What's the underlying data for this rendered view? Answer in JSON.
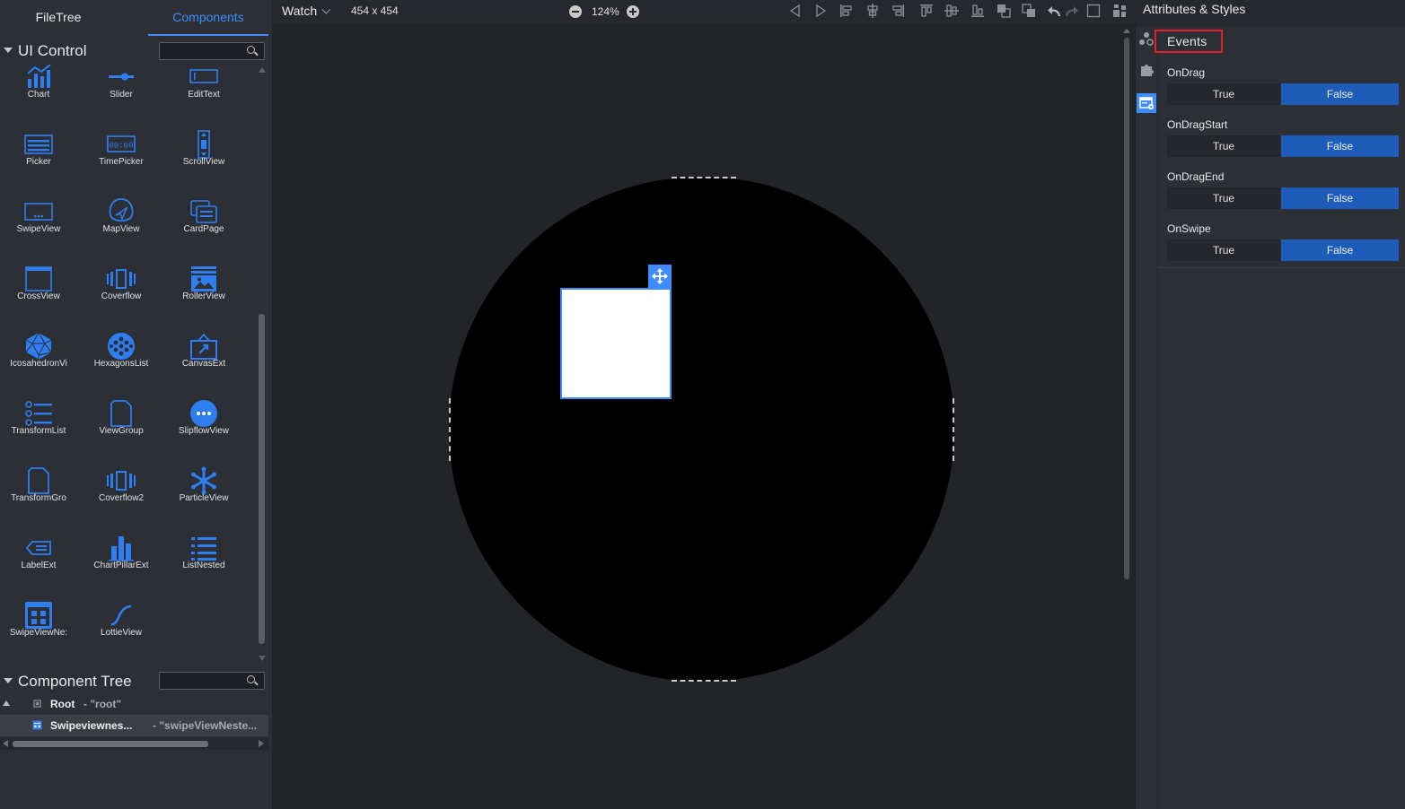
{
  "left_tabs": {
    "filetree": "FileTree",
    "components": "Components"
  },
  "ui_control": {
    "title": "UI Control",
    "search_placeholder": "",
    "items": [
      {
        "label": "Chart",
        "icon": "chart-icon"
      },
      {
        "label": "Slider",
        "icon": "slider-icon"
      },
      {
        "label": "EditText",
        "icon": "edittext-icon"
      },
      {
        "label": "Picker",
        "icon": "picker-icon"
      },
      {
        "label": "TimePicker",
        "icon": "timepicker-icon"
      },
      {
        "label": "ScrollView",
        "icon": "scrollview-icon"
      },
      {
        "label": "SwipeView",
        "icon": "swipeview-icon"
      },
      {
        "label": "MapView",
        "icon": "mapview-icon"
      },
      {
        "label": "CardPage",
        "icon": "cardpage-icon"
      },
      {
        "label": "CrossView",
        "icon": "crossview-icon"
      },
      {
        "label": "Coverflow",
        "icon": "coverflow-icon"
      },
      {
        "label": "RollerView",
        "icon": "rollerview-icon"
      },
      {
        "label": "IcosahedronVi",
        "icon": "icosahedron-icon"
      },
      {
        "label": "HexagonsList",
        "icon": "hexagonslist-icon"
      },
      {
        "label": "CanvasExt",
        "icon": "canvasext-icon"
      },
      {
        "label": "TransformList",
        "icon": "transformlist-icon"
      },
      {
        "label": "ViewGroup",
        "icon": "viewgroup-icon"
      },
      {
        "label": "SlipflowView",
        "icon": "slipflowview-icon"
      },
      {
        "label": "TransformGro",
        "icon": "transformgroup-icon"
      },
      {
        "label": "Coverflow2",
        "icon": "coverflow2-icon"
      },
      {
        "label": "ParticleView",
        "icon": "particleview-icon"
      },
      {
        "label": "LabelExt",
        "icon": "labelext-icon"
      },
      {
        "label": "ChartPillarExt",
        "icon": "chartpillar-icon"
      },
      {
        "label": "ListNested",
        "icon": "listnested-icon"
      },
      {
        "label": "SwipeViewNe:",
        "icon": "swipeviewnested-icon"
      },
      {
        "label": "LottieView",
        "icon": "lottieview-icon"
      }
    ]
  },
  "component_tree": {
    "title": "Component Tree",
    "search_placeholder": "",
    "nodes": [
      {
        "name": "Root",
        "id": "- \"root\""
      },
      {
        "name": "Swipeviewnes...",
        "id": "- \"swipeViewNeste..."
      }
    ]
  },
  "toolbar": {
    "device": "Watch",
    "size": "454 x 454",
    "zoom": "124%",
    "icons": [
      "prev-icon",
      "next-icon",
      "align-left-icon",
      "align-center-h-icon",
      "align-right-icon",
      "align-top-icon",
      "align-middle-v-icon",
      "align-bottom-icon",
      "bring-front-icon",
      "send-back-icon",
      "undo-icon",
      "redo-icon",
      "checkbox-icon",
      "layout-icon"
    ]
  },
  "right_panel": {
    "title": "Attributes & Styles",
    "section": "Events",
    "rail_icons": [
      "attributes-icon",
      "puzzle-icon",
      "events-icon"
    ],
    "events": [
      {
        "name": "OnDrag",
        "true_label": "True",
        "false_label": "False",
        "value": false
      },
      {
        "name": "OnDragStart",
        "true_label": "True",
        "false_label": "False",
        "value": false
      },
      {
        "name": "OnDragEnd",
        "true_label": "True",
        "false_label": "False",
        "value": false
      },
      {
        "name": "OnSwipe",
        "true_label": "True",
        "false_label": "False",
        "value": false
      }
    ]
  },
  "colors": {
    "accent": "#3f8cff",
    "selected": "#1d5cb8",
    "highlight_border": "#e0212b"
  }
}
